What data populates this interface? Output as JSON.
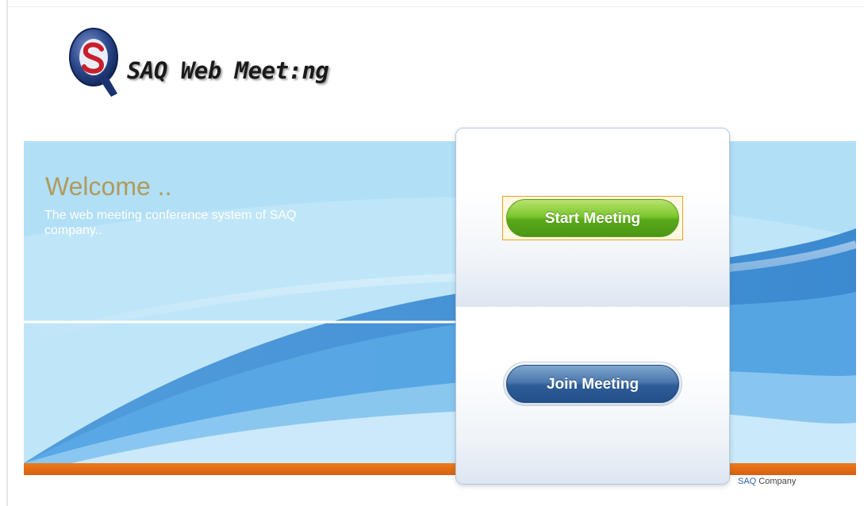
{
  "logo": {
    "text": "SAQ Web Meet:ng",
    "icon": "saq-logo-icon"
  },
  "banner": {
    "welcome_title": "Welcome ..",
    "welcome_text": "The web meeting conference system of SAQ company.."
  },
  "panel": {
    "start_button": "Start Meeting",
    "join_button": "Join Meeting"
  },
  "footer": {
    "brand": "SAQ",
    "company": " Company"
  },
  "colors": {
    "accent_orange": "#e06a14",
    "start_green": "#6ab723",
    "join_blue": "#2d5c96",
    "welcome_gold": "#b19a5c"
  }
}
